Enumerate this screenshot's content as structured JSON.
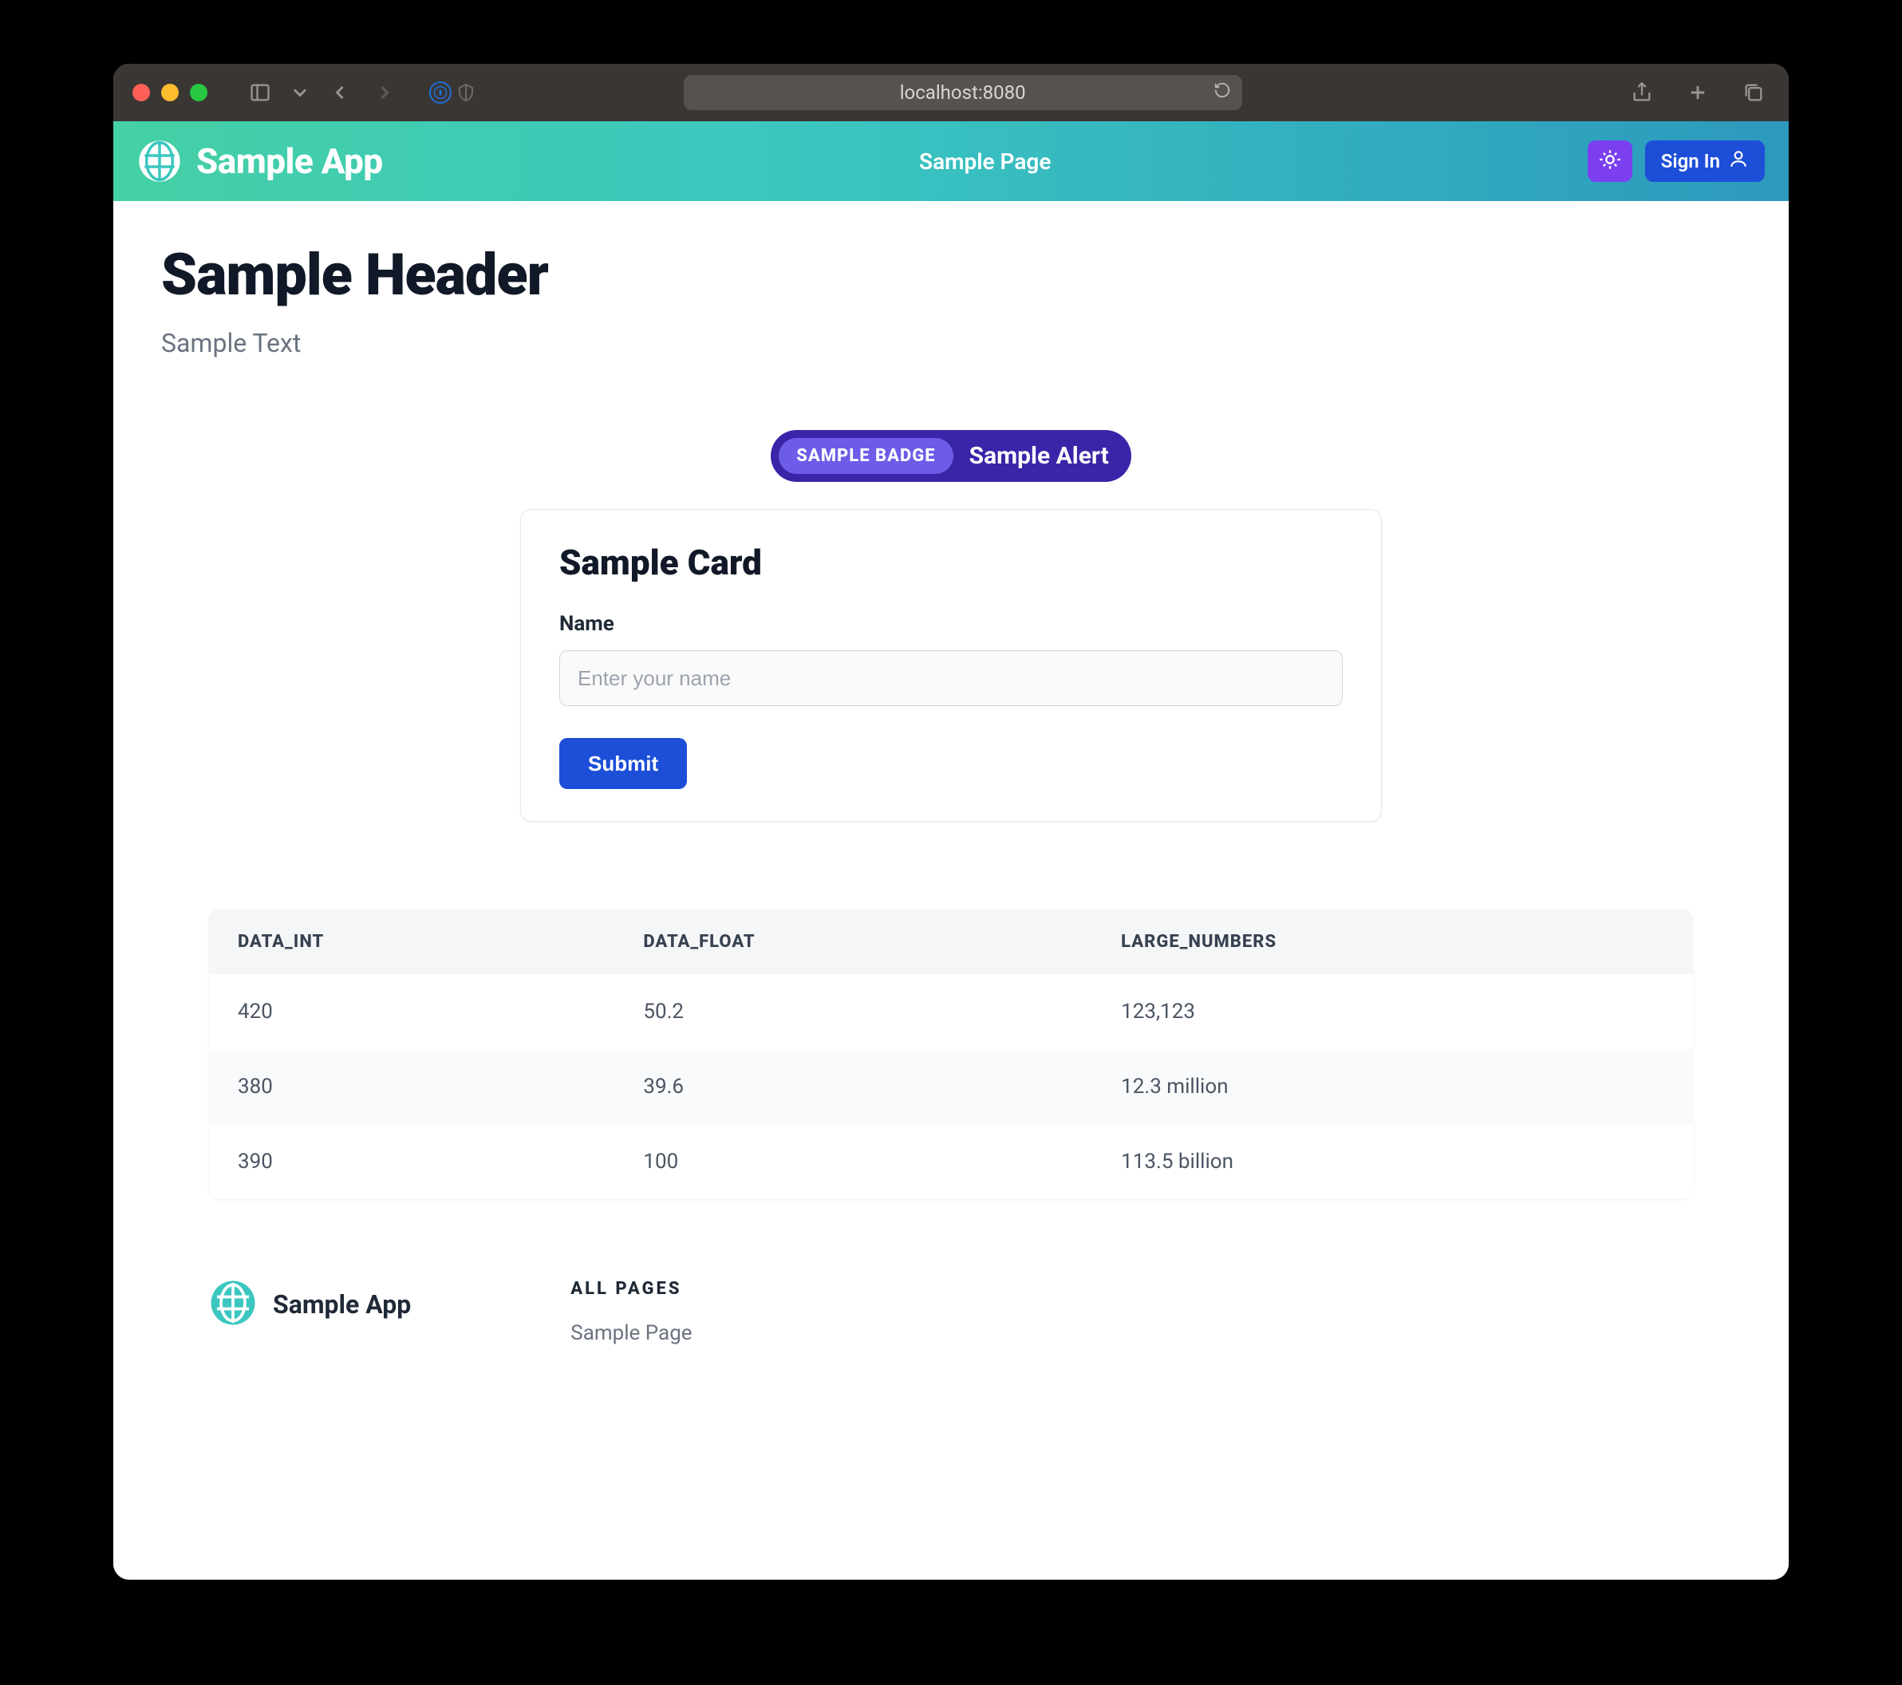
{
  "browser": {
    "address": "localhost:8080"
  },
  "navbar": {
    "brand": "Sample App",
    "nav_link": "Sample Page",
    "signin_label": "Sign In"
  },
  "header": {
    "title": "Sample Header",
    "subtitle": "Sample Text"
  },
  "alert": {
    "badge": "SAMPLE BADGE",
    "text": "Sample Alert"
  },
  "card": {
    "title": "Sample Card",
    "input_label": "Name",
    "input_placeholder": "Enter your name",
    "submit_label": "Submit"
  },
  "table": {
    "columns": [
      "DATA_INT",
      "DATA_FLOAT",
      "LARGE_NUMBERS"
    ],
    "rows": [
      {
        "c0": "420",
        "c1": "50.2",
        "c2": "123,123"
      },
      {
        "c0": "380",
        "c1": "39.6",
        "c2": "12.3 million"
      },
      {
        "c0": "390",
        "c1": "100",
        "c2": "113.5 billion"
      }
    ]
  },
  "footer": {
    "brand": "Sample App",
    "column_title": "ALL PAGES",
    "link": "Sample Page"
  }
}
